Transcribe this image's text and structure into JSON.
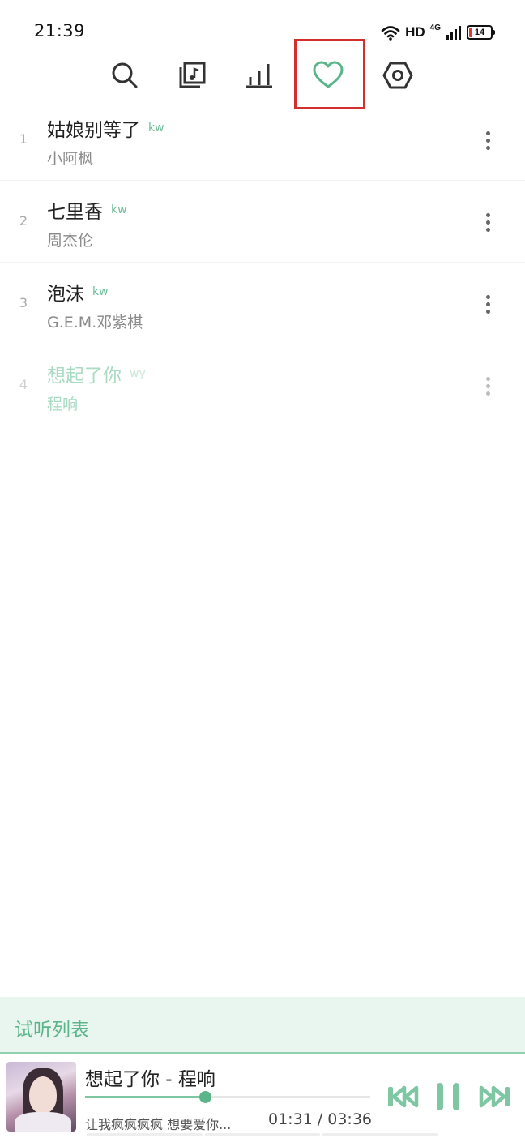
{
  "status_bar": {
    "time": "21:39",
    "signal_label": "HD",
    "network_label": "4G",
    "battery_level": "14",
    "icons": [
      "wifi-icon",
      "signal-bars-icon",
      "battery-icon"
    ]
  },
  "toolbar": {
    "items": [
      {
        "name": "search",
        "icon": "search-icon",
        "active": false
      },
      {
        "name": "songlist",
        "icon": "music-note-icon",
        "active": false
      },
      {
        "name": "leaderboard",
        "icon": "bar-chart-icon",
        "active": false
      },
      {
        "name": "favorites",
        "icon": "heart-icon",
        "active": true
      },
      {
        "name": "settings",
        "icon": "hexagon-gear-icon",
        "active": false
      }
    ],
    "accent_color": "#5cb58a",
    "highlight_color": "#d32f2f"
  },
  "songs": [
    {
      "index": "1",
      "title": "姑娘别等了",
      "source": "kw",
      "artist": "小阿枫",
      "playing": false
    },
    {
      "index": "2",
      "title": "七里香",
      "source": "kw",
      "artist": "周杰伦",
      "playing": false
    },
    {
      "index": "3",
      "title": "泡沫",
      "source": "kw",
      "artist": "G.E.M.邓紫棋",
      "playing": false
    },
    {
      "index": "4",
      "title": "想起了你",
      "source": "wy",
      "artist": "程响",
      "playing": true
    }
  ],
  "playlist_bar": {
    "label": "试听列表"
  },
  "player": {
    "title": "想起了你 - 程响",
    "lyric": "让我疯疯疯疯 想要爱你...",
    "current_time": "01:31",
    "separator": " / ",
    "total_time": "03:36",
    "progress": 0.42,
    "controls": [
      "prev-icon",
      "pause-icon",
      "next-icon"
    ]
  }
}
